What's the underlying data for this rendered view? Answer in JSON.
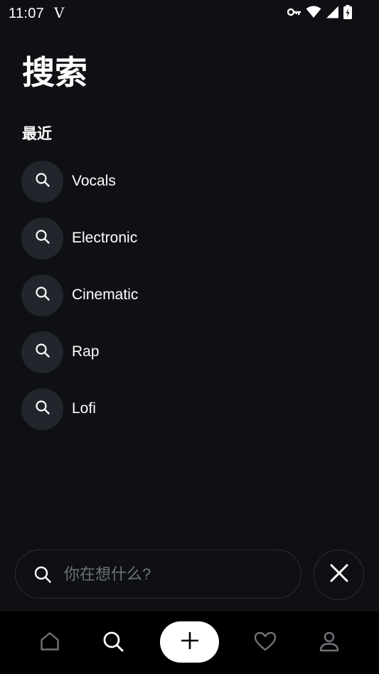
{
  "status_bar": {
    "time": "11:07",
    "carrier_glyph": "V",
    "icons": [
      "vpn-key-icon",
      "wifi-icon",
      "signal-icon",
      "battery-charging-icon"
    ]
  },
  "header": {
    "title": "搜索"
  },
  "recent": {
    "section_title": "最近",
    "items": [
      {
        "label": "Vocals",
        "icon": "search-icon"
      },
      {
        "label": "Electronic",
        "icon": "search-icon"
      },
      {
        "label": "Cinematic",
        "icon": "search-icon"
      },
      {
        "label": "Rap",
        "icon": "search-icon"
      },
      {
        "label": "Lofi",
        "icon": "search-icon"
      }
    ]
  },
  "search": {
    "placeholder": "你在想什么?",
    "value": "",
    "icon": "search-icon",
    "close_icon": "close-icon"
  },
  "bottom_nav": {
    "items": [
      {
        "name": "home",
        "icon": "home-icon",
        "active": false
      },
      {
        "name": "search",
        "icon": "search-icon",
        "active": true
      },
      {
        "name": "create",
        "icon": "plus-icon",
        "active": false
      },
      {
        "name": "favorites",
        "icon": "heart-icon",
        "active": false
      },
      {
        "name": "profile",
        "icon": "user-icon",
        "active": false
      }
    ]
  },
  "colors": {
    "background": "#0e1013",
    "chip": "#22252b",
    "placeholder": "#6d7077",
    "inactive_icon": "#6f737a",
    "nav_background": "#000000",
    "accent": "#ffffff"
  }
}
